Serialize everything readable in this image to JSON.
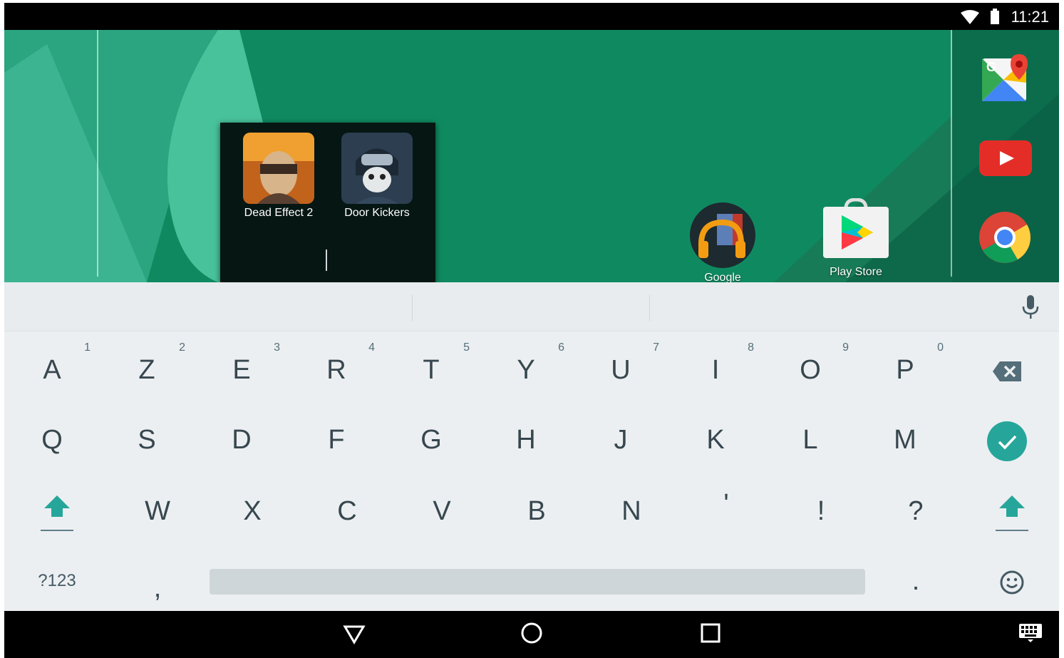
{
  "status_bar": {
    "time": "11:21"
  },
  "folder": {
    "apps": [
      {
        "label": "Dead Effect 2",
        "icon": "dead-effect-2-icon"
      },
      {
        "label": "Door Kickers",
        "icon": "door-kickers-icon"
      }
    ]
  },
  "home_apps": [
    {
      "label": "Google",
      "icon": "google-play-music-icon"
    },
    {
      "label": "Play Store",
      "icon": "play-store-icon"
    }
  ],
  "dock": [
    "google-maps-icon",
    "youtube-icon",
    "chrome-icon"
  ],
  "keyboard": {
    "suggestions": [
      "",
      "",
      ""
    ],
    "row1": [
      {
        "key": "A",
        "hint": "1"
      },
      {
        "key": "Z",
        "hint": "2"
      },
      {
        "key": "E",
        "hint": "3"
      },
      {
        "key": "R",
        "hint": "4"
      },
      {
        "key": "T",
        "hint": "5"
      },
      {
        "key": "Y",
        "hint": "6"
      },
      {
        "key": "U",
        "hint": "7"
      },
      {
        "key": "I",
        "hint": "8"
      },
      {
        "key": "O",
        "hint": "9"
      },
      {
        "key": "P",
        "hint": "0"
      }
    ],
    "row2": [
      "Q",
      "S",
      "D",
      "F",
      "G",
      "H",
      "J",
      "K",
      "L",
      "M"
    ],
    "row3": [
      "W",
      "X",
      "C",
      "V",
      "B",
      "N",
      "'",
      "!",
      "?"
    ],
    "symbols_label": "?123",
    "comma": ",",
    "period": ".",
    "accent_color": "#26a69a"
  }
}
